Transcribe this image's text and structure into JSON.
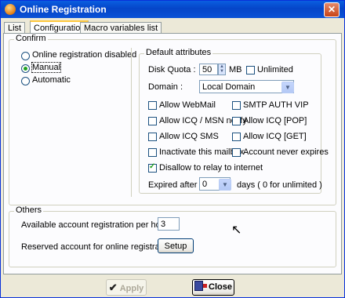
{
  "window": {
    "title": "Online Registration",
    "close_glyph": "✕"
  },
  "tabs": [
    {
      "label": "List",
      "active": false
    },
    {
      "label": "Configuration",
      "active": true
    },
    {
      "label": "Macro variables list",
      "active": false
    }
  ],
  "confirm": {
    "legend": "Confirm",
    "options": [
      {
        "label": "Online registration disabled",
        "selected": false
      },
      {
        "label": "Manual",
        "selected": true
      },
      {
        "label": "Automatic",
        "selected": false
      }
    ]
  },
  "defaults": {
    "legend": "Default attributes",
    "disk_quota": {
      "label": "Disk Quota :",
      "value": "50",
      "unit": "MB"
    },
    "unlimited": {
      "label": "Unlimited",
      "checked": false
    },
    "domain": {
      "label": "Domain :",
      "value": "Local Domain"
    },
    "checkboxes": [
      {
        "label": "Allow WebMail",
        "checked": false
      },
      {
        "label": "SMTP AUTH VIP",
        "checked": false
      },
      {
        "label": "Allow ICQ / MSN notify",
        "checked": false
      },
      {
        "label": "Allow ICQ [POP]",
        "checked": false
      },
      {
        "label": "Allow ICQ SMS",
        "checked": false
      },
      {
        "label": "Allow ICQ [GET]",
        "checked": false
      },
      {
        "label": "Inactivate this mailbox",
        "checked": false
      },
      {
        "label": "Account never expires",
        "checked": false
      },
      {
        "label": "Disallow to relay to internet",
        "checked": true
      }
    ],
    "expired": {
      "label": "Expired after",
      "value": "0",
      "suffix": "days ( 0 for unlimited )"
    }
  },
  "others": {
    "legend": "Others",
    "per_hour": {
      "label": "Available account registration per hour :",
      "value": "3"
    },
    "reserved": {
      "label": "Reserved account for online registration",
      "button": "Setup"
    }
  },
  "footer": {
    "apply_label": "Apply",
    "close_label": "Close"
  },
  "icons": {
    "apply": "checkmark-icon",
    "close": "door-exit-icon",
    "app": "app-globe-icon"
  },
  "colors": {
    "title_bar": "#0545c8",
    "window_bg": "#ece9d8",
    "selected_radio": "#21a121"
  }
}
